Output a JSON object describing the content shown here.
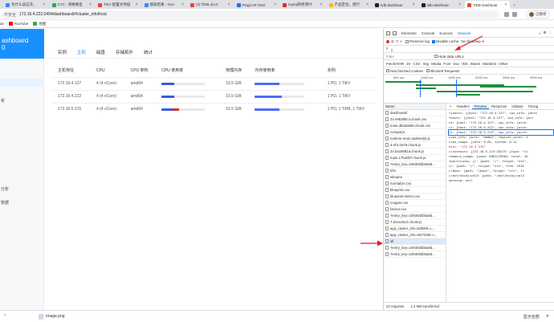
{
  "browser": {
    "tabs": [
      {
        "title": "为什么该这次，",
        "color": "#4285f4",
        "active": false
      },
      {
        "title": "CTC - 清要要是",
        "color": "#34a853",
        "active": false
      },
      {
        "title": "TiKV 配置文件描",
        "color": "#ea4335",
        "active": false
      },
      {
        "title": "搜索结果 - Goo",
        "color": "#4285f4",
        "active": false
      },
      {
        "title": "(2) TiDB 从v3.",
        "color": "#ea4335",
        "active": false
      },
      {
        "title": "PingCAP SSO",
        "color": "#1a73e8",
        "active": false
      },
      {
        "title": "mysql的所谓什",
        "color": "#d93025",
        "active": false
      },
      {
        "title": "产品定位，借行",
        "color": "#fbbc04",
        "active": false
      },
      {
        "title": "tidb-dashboar",
        "color": "#202124",
        "active": false
      },
      {
        "title": "tidb-dashboar",
        "color": "#202124",
        "active": false
      },
      {
        "title": "TiDB Dashboar",
        "color": "#ea4335",
        "active": true
      }
    ],
    "insecure_label": "不安全",
    "url": "172.16.4.222:2494/dashboard/#/cluster_info/host",
    "profile_label": "已暂停",
    "bookmarks": [
      "ail",
      "YouTube",
      "地图"
    ]
  },
  "sidebar": {
    "brand_line1": "ashboard",
    "brand_line2": "0",
    "items": [
      {
        "label": "",
        "active": true
      },
      {
        "label": "析",
        "active": false
      },
      {
        "label": "分析",
        "active": false
      },
      {
        "label": "数据",
        "active": false
      }
    ]
  },
  "main": {
    "subtabs": [
      "实例",
      "主机",
      "磁盘",
      "存储拓扑",
      "统计"
    ],
    "active_subtab": 1,
    "columns": [
      "主机地址",
      "CPU",
      "CPU 架构",
      "CPU 使用率",
      "物理内存",
      "内存使用率",
      "实例"
    ],
    "rows": [
      {
        "host": "172.16.4.127",
        "cpu": "4 (4 vCore)",
        "arch": "amd64",
        "cpu_user": 0.3,
        "cpu_sys": 0.0,
        "memory": "15.5 GiB",
        "mem_usage": 0.5,
        "instances": "1 PD, 1 TiKV"
      },
      {
        "host": "172.16.4.222",
        "cpu": "4 (4 vCore)",
        "arch": "amd64",
        "cpu_user": 0.3,
        "cpu_sys": 0.0,
        "memory": "15.5 GiB",
        "mem_usage": 0.55,
        "instances": "1 PD, 1 TiKV"
      },
      {
        "host": "172.16.5.215",
        "cpu": "4 (4 vCore)",
        "arch": "amd64",
        "cpu_user": 0.25,
        "cpu_sys": 0.15,
        "memory": "15.5 GiB",
        "mem_usage": 0.5,
        "instances": "1 PD, 1 TiDB, 1 TiKV"
      }
    ]
  },
  "devtools": {
    "panels": [
      "Elements",
      "Console",
      "Sources",
      "Network"
    ],
    "active_panel": "Network",
    "preserve_log": "Preserve log",
    "disable_cache": "Disable cache",
    "throttling": "No throttling",
    "filter_placeholder": "Filter",
    "hide_data_urls": "Hide data URLs",
    "type_filters": [
      "Fetch/XHR",
      "JS",
      "CSS",
      "Img",
      "Media",
      "Font",
      "Doc",
      "WS",
      "Wasm",
      "Manifest",
      "Other"
    ],
    "has_blocked_cookies": "Has blocked cookies",
    "blocked_requests": "Blocked Requests",
    "timeline_ticks": [
      "500 ms",
      "1000 ms",
      "1500 ms",
      "2000 ms",
      "2500 ms",
      "3000 ms"
    ],
    "name_header": "Name",
    "requests": [
      "dashboard/",
      "34.e8539bc4.chunk.css",
      "main.db0da558.chunk.css",
      "compat.js",
      "runtime-main.3a49e483.js",
      "4.ef1c1579.chunk.js",
      "24.ba19081a.chunk.js",
      "main.17ba0b7.chunk.js",
      "?entry_key=10930d3b0a8d...",
      "info",
      "whoami",
      "normalize.css",
      "blueprint.css",
      "blueprint-select.css",
      "cropper.css",
      "favicon.ico",
      "?entry_key=10930d3b0a8d...",
      "7.844145c3.chunk.js",
      "app_cluster_info.2af929c.c...",
      "app_cluster_info.c847339c.c...",
      "all",
      "?entry_key=10930d3b0a8d...",
      "?entry_key=10930d3b0a8d..."
    ],
    "selected_request": "all",
    "detail_tabs": [
      "×",
      "Headers",
      "Preview",
      "Response",
      "Initiator",
      "Timing"
    ],
    "active_detail_tab": "Preview",
    "preview_lines": [
      "▾{hosts: [{host: \"172.16.4.127\", cpu_info: {arch",
      "  ▾hosts: [{host: \"172.16.4.127\", cpu_info: {arc",
      "    ▸0: {host: \"172.16.4.127\", cpu_info: {arch:",
      "    ▸1: {host: \"172.16.4.222\", cpu_info: {arch:",
      "    ▾2: {host: \"172.16.5.215\", cpu_info: {arch:",
      "      ▸cpu_info: {arch: \"amd64\", logical_cores: 4",
      "      ▸cpu_usage: {idle: 0.64, system: 0.1}",
      "       host: \"172.16.5.215\"",
      "      ▸instances: {172.16.5.215:20275: {type: \"ti",
      "      ▸memory_usage: {used: 6981129984, total: 16",
      "      ▾partitions: {/: {path: \"/\", fstype: \"xfs\",",
      "        ▸/: {path: \"/\", fstype: \"xfs\", free: 2916",
      "        ▸/boot: {path: \"/boot\", fstype: \"xfs\", fr",
      "        ▸/mnt/disks/vol3: {path: \"/mnt/disks/vol3",
      "    warning: null"
    ],
    "status_requests": "23 requests",
    "status_transferred": "1.2 MB transferred"
  },
  "downloads": {
    "filename": "image.png",
    "show_all": "显示全部"
  },
  "colors": {
    "accent": "#1890ff",
    "annotation": "#e02020"
  }
}
